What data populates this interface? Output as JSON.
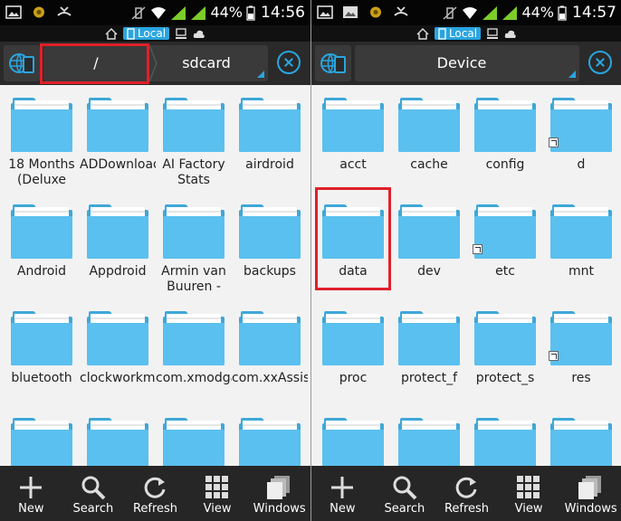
{
  "colors": {
    "accent": "#2aa5e0",
    "folder": "#5ac0ef",
    "folder_dark": "#3ea8d9",
    "highlight": "#e0202a",
    "bar": "#262626",
    "background": "#f2f2f2"
  },
  "panes": [
    {
      "status": {
        "battery": "44%",
        "time": "14:56"
      },
      "mode_label": "Local",
      "toolbar": {
        "crumbs": [
          "/",
          "sdcard"
        ]
      },
      "folders": [
        {
          "name": "18 Months (Deluxe",
          "link": false
        },
        {
          "name": "ADDownloads",
          "link": false
        },
        {
          "name": "AI Factory Stats",
          "link": false
        },
        {
          "name": "airdroid",
          "link": false
        },
        {
          "name": "Android",
          "link": false
        },
        {
          "name": "Appdroid",
          "link": false
        },
        {
          "name": "Armin van Buuren -",
          "link": false
        },
        {
          "name": "backups",
          "link": false
        },
        {
          "name": "bluetooth",
          "link": false
        },
        {
          "name": "clockworkmod",
          "link": false
        },
        {
          "name": "com.xmodgame",
          "link": false
        },
        {
          "name": "com.xxAssistant",
          "link": false
        },
        {
          "name": "",
          "link": false
        },
        {
          "name": "",
          "link": false
        },
        {
          "name": "",
          "link": false
        },
        {
          "name": "",
          "link": false
        }
      ],
      "bottom": [
        {
          "label": "New",
          "icon": "plus-icon"
        },
        {
          "label": "Search",
          "icon": "search-icon"
        },
        {
          "label": "Refresh",
          "icon": "refresh-icon"
        },
        {
          "label": "View",
          "icon": "grid-icon"
        },
        {
          "label": "Windows",
          "icon": "windows-icon"
        }
      ]
    },
    {
      "status": {
        "battery": "44%",
        "time": "14:57"
      },
      "mode_label": "Local",
      "toolbar": {
        "crumbs": [
          "Device"
        ]
      },
      "folders": [
        {
          "name": "acct",
          "link": false
        },
        {
          "name": "cache",
          "link": false
        },
        {
          "name": "config",
          "link": false
        },
        {
          "name": "d",
          "link": true
        },
        {
          "name": "data",
          "link": false
        },
        {
          "name": "dev",
          "link": false
        },
        {
          "name": "etc",
          "link": true
        },
        {
          "name": "mnt",
          "link": false
        },
        {
          "name": "proc",
          "link": false
        },
        {
          "name": "protect_f",
          "link": false
        },
        {
          "name": "protect_s",
          "link": false
        },
        {
          "name": "res",
          "link": true
        },
        {
          "name": "",
          "link": false
        },
        {
          "name": "",
          "link": false
        },
        {
          "name": "",
          "link": false
        },
        {
          "name": "",
          "link": false
        }
      ],
      "bottom": [
        {
          "label": "New",
          "icon": "plus-icon"
        },
        {
          "label": "Search",
          "icon": "search-icon"
        },
        {
          "label": "Refresh",
          "icon": "refresh-icon"
        },
        {
          "label": "View",
          "icon": "grid-icon"
        },
        {
          "label": "Windows",
          "icon": "windows-icon"
        }
      ]
    }
  ]
}
